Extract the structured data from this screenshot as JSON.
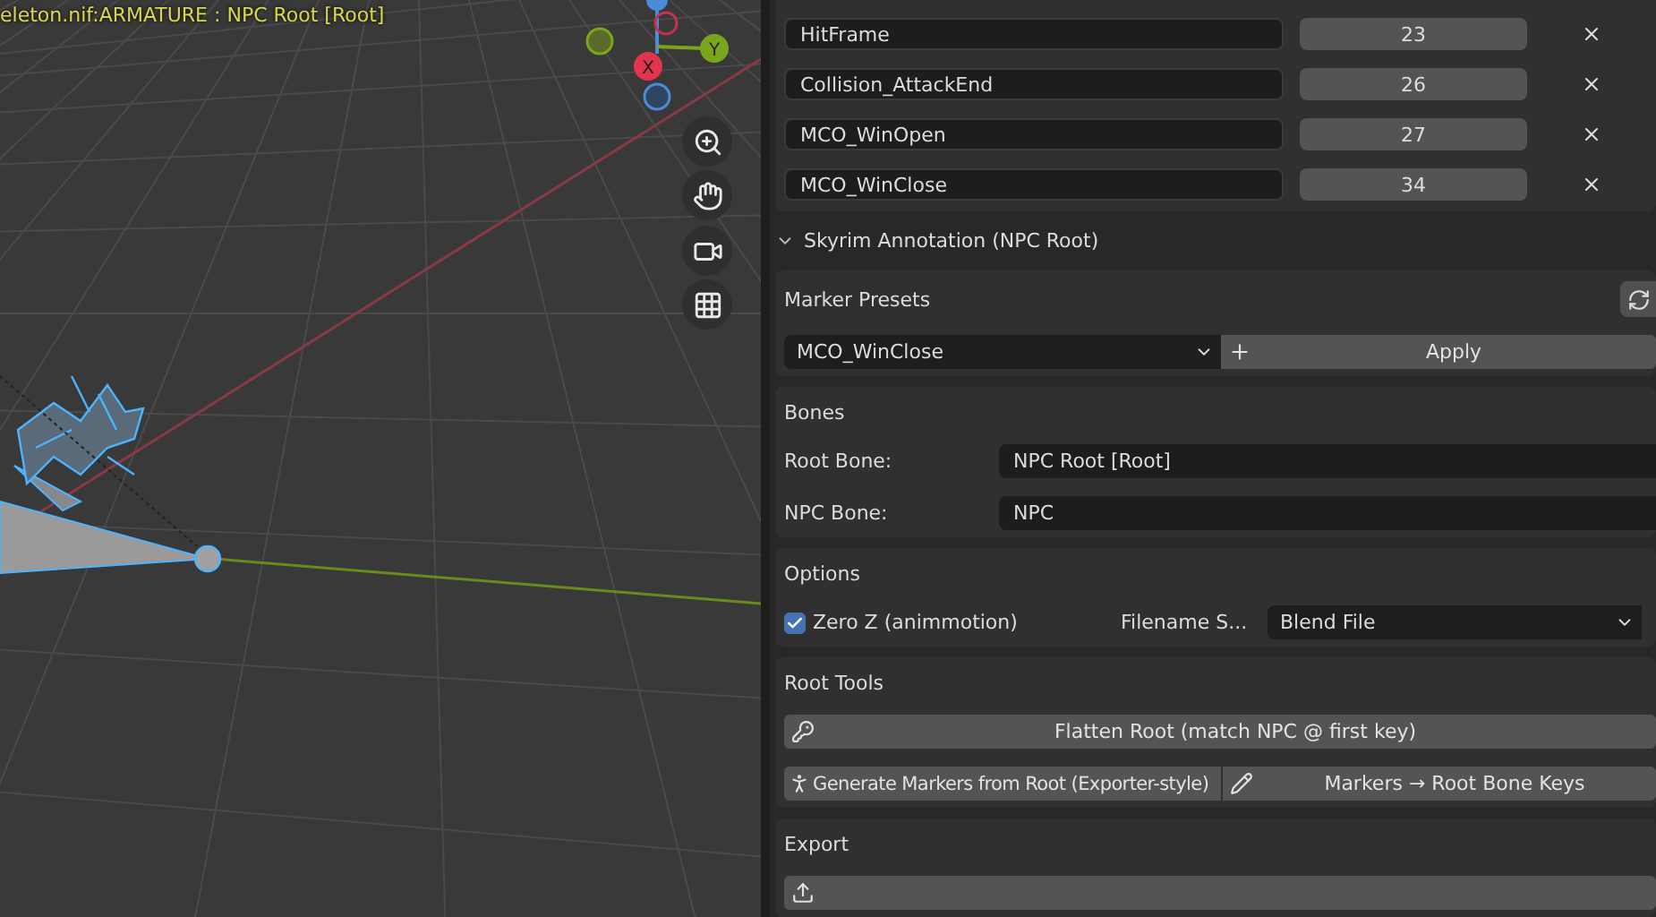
{
  "viewport": {
    "header": "eleton.nif:ARMATURE : NPC Root [Root]",
    "gizmo": {
      "x_label": "X",
      "y_label": "Y"
    }
  },
  "markers": [
    {
      "name": "HitFrame",
      "frame": "23"
    },
    {
      "name": "Collision_AttackEnd",
      "frame": "26"
    },
    {
      "name": "MCO_WinOpen",
      "frame": "27"
    },
    {
      "name": "MCO_WinClose",
      "frame": "34"
    }
  ],
  "panel": {
    "title": "Skyrim Annotation (NPC Root)",
    "expanded": true,
    "marker_presets": {
      "title": "Marker Presets",
      "preset": "MCO_WinClose",
      "apply": "Apply"
    },
    "bones": {
      "title": "Bones",
      "fields": [
        {
          "label": "Root Bone:",
          "value": "NPC Root [Root]"
        },
        {
          "label": "NPC Bone:",
          "value": "NPC"
        }
      ]
    },
    "options": {
      "title": "Options",
      "zero_z": {
        "label": "Zero Z (animmotion)",
        "checked": true
      },
      "filename_label": "Filename S...",
      "filename_value": "Blend File"
    },
    "root_tools": {
      "title": "Root Tools",
      "flatten": "Flatten Root (match NPC @ first key)",
      "generate": "Generate Markers from Root (Exporter-style)",
      "markers_to_keys": "Markers → Root Bone Keys"
    },
    "export": {
      "title": "Export"
    }
  }
}
